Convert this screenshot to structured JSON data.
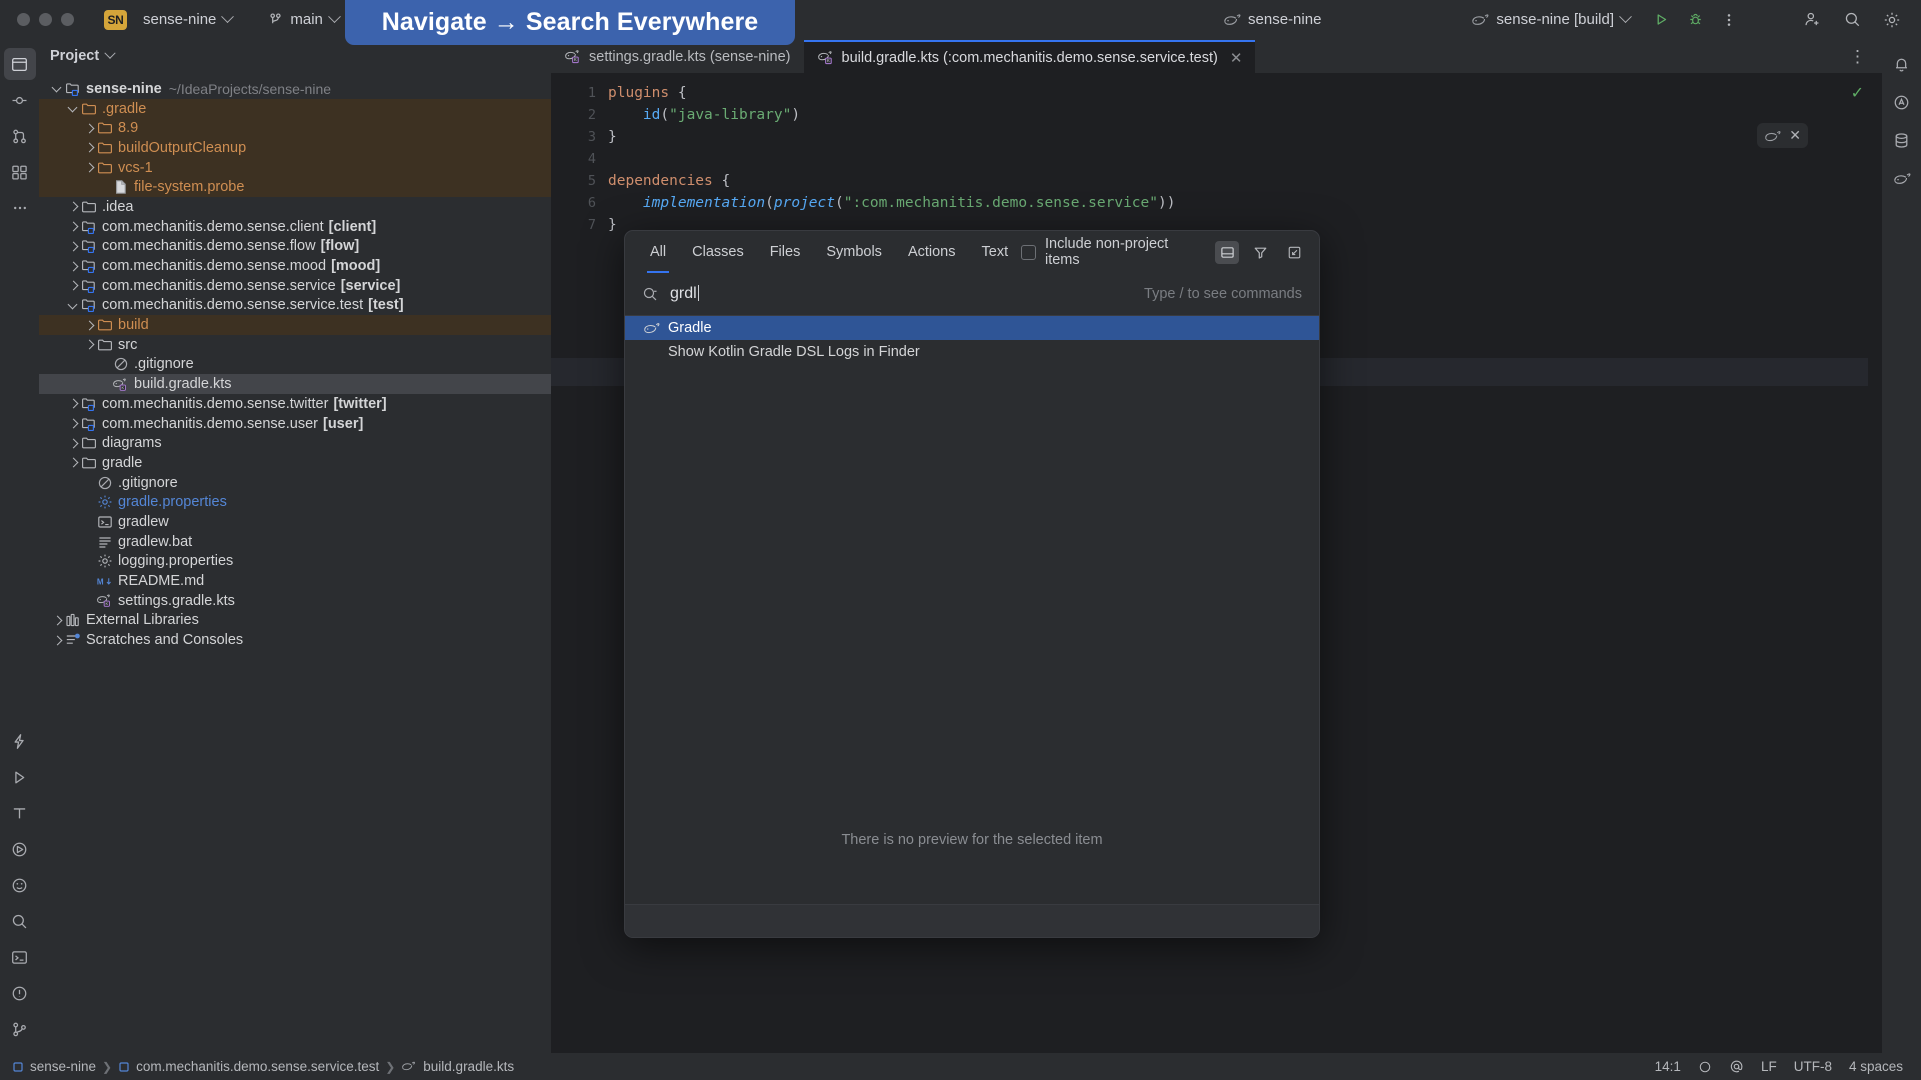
{
  "titlebar": {
    "project_badge": "SN",
    "project_name": "sense-nine",
    "branch": "main",
    "gradle_project": "sense-nine",
    "run_config": "sense-nine [build]",
    "icons": {
      "run": "run-icon",
      "debug": "debug-icon",
      "more": "more-vertical-icon",
      "add_user": "add-user-icon",
      "search": "search-icon",
      "settings": "gear-icon"
    }
  },
  "banner": {
    "text": "Navigate → Search Everywhere",
    "color": "#3c63ad"
  },
  "project_panel": {
    "title": "Project",
    "tree": [
      {
        "label": "sense-nine",
        "suffix": "~/IdeaProjects/sense-nine",
        "indent": 0,
        "arrow": "down",
        "icon": "module-folder-icon",
        "bold": true
      },
      {
        "label": ".gradle",
        "indent": 1,
        "arrow": "down",
        "icon": "folder-icon",
        "style": "excluded"
      },
      {
        "label": "8.9",
        "indent": 2,
        "arrow": "right",
        "icon": "folder-icon",
        "style": "excluded"
      },
      {
        "label": "buildOutputCleanup",
        "indent": 2,
        "arrow": "right",
        "icon": "folder-icon",
        "style": "excluded"
      },
      {
        "label": "vcs-1",
        "indent": 2,
        "arrow": "right",
        "icon": "folder-icon",
        "style": "excluded"
      },
      {
        "label": "file-system.probe",
        "indent": 3,
        "arrow": "none",
        "icon": "file-icon",
        "style": "excluded"
      },
      {
        "label": ".idea",
        "indent": 1,
        "arrow": "right",
        "icon": "folder-icon"
      },
      {
        "label": "com.mechanitis.demo.sense.client",
        "module": "[client]",
        "indent": 1,
        "arrow": "right",
        "icon": "module-folder-icon"
      },
      {
        "label": "com.mechanitis.demo.sense.flow",
        "module": "[flow]",
        "indent": 1,
        "arrow": "right",
        "icon": "module-folder-icon"
      },
      {
        "label": "com.mechanitis.demo.sense.mood",
        "module": "[mood]",
        "indent": 1,
        "arrow": "right",
        "icon": "module-folder-icon"
      },
      {
        "label": "com.mechanitis.demo.sense.service",
        "module": "[service]",
        "indent": 1,
        "arrow": "right",
        "icon": "module-folder-icon"
      },
      {
        "label": "com.mechanitis.demo.sense.service.test",
        "module": "[test]",
        "indent": 1,
        "arrow": "down",
        "icon": "module-folder-icon"
      },
      {
        "label": "build",
        "indent": 2,
        "arrow": "right",
        "icon": "folder-icon",
        "style": "excluded"
      },
      {
        "label": "src",
        "indent": 2,
        "arrow": "right",
        "icon": "folder-icon"
      },
      {
        "label": ".gitignore",
        "indent": 3,
        "arrow": "none",
        "icon": "gitignore-icon"
      },
      {
        "label": "build.gradle.kts",
        "indent": 3,
        "arrow": "none",
        "icon": "gradle-kts-icon",
        "style": "selected"
      },
      {
        "label": "com.mechanitis.demo.sense.twitter",
        "module": "[twitter]",
        "indent": 1,
        "arrow": "right",
        "icon": "module-folder-icon"
      },
      {
        "label": "com.mechanitis.demo.sense.user",
        "module": "[user]",
        "indent": 1,
        "arrow": "right",
        "icon": "module-folder-icon"
      },
      {
        "label": "diagrams",
        "indent": 1,
        "arrow": "right",
        "icon": "folder-icon"
      },
      {
        "label": "gradle",
        "indent": 1,
        "arrow": "right",
        "icon": "folder-icon"
      },
      {
        "label": ".gitignore",
        "indent": 2,
        "arrow": "none",
        "icon": "gitignore-icon"
      },
      {
        "label": "gradle.properties",
        "indent": 2,
        "arrow": "none",
        "icon": "properties-icon",
        "style": "blue"
      },
      {
        "label": "gradlew",
        "indent": 2,
        "arrow": "none",
        "icon": "shell-script-icon"
      },
      {
        "label": "gradlew.bat",
        "indent": 2,
        "arrow": "none",
        "icon": "text-file-icon"
      },
      {
        "label": "logging.properties",
        "indent": 2,
        "arrow": "none",
        "icon": "properties-icon"
      },
      {
        "label": "README.md",
        "indent": 2,
        "arrow": "none",
        "icon": "markdown-icon"
      },
      {
        "label": "settings.gradle.kts",
        "indent": 2,
        "arrow": "none",
        "icon": "gradle-kts-icon"
      },
      {
        "label": "External Libraries",
        "indent": 0,
        "arrow": "right",
        "icon": "library-icon"
      },
      {
        "label": "Scratches and Consoles",
        "indent": 0,
        "arrow": "right",
        "icon": "scratches-icon"
      }
    ]
  },
  "editor": {
    "tabs": [
      {
        "label": "settings.gradle.kts (sense-nine)",
        "icon": "gradle-kts-icon",
        "active": false
      },
      {
        "label": "build.gradle.kts (:com.mechanitis.demo.sense.service.test)",
        "icon": "gradle-kts-icon",
        "active": true,
        "closable": true
      }
    ],
    "gutter": [
      "1",
      "2",
      "3",
      "4",
      "5",
      "6",
      "7"
    ],
    "lines": [
      "plugins {",
      "    id(\"java-library\")",
      "}",
      "",
      "dependencies {",
      "    implementation(project(\":com.mechanitis.demo.sense.service\"))",
      "}"
    ]
  },
  "search_everywhere": {
    "tabs": [
      "All",
      "Classes",
      "Files",
      "Symbols",
      "Actions",
      "Text"
    ],
    "active_tab": "All",
    "include_non_project_label": "Include non-project items",
    "include_non_project_checked": false,
    "header_icons": [
      "preview-panel-icon",
      "filter-icon",
      "resize-icon"
    ],
    "query": "grdl",
    "commands_hint": "Type / to see commands",
    "results": [
      {
        "label": "Gradle",
        "icon": "gradle-icon",
        "selected": true
      },
      {
        "label": "Show Kotlin Gradle DSL Logs in Finder",
        "icon": "none",
        "selected": false
      }
    ],
    "preview_empty_text": "There is no preview for the selected item"
  },
  "status_bar": {
    "breadcrumbs": [
      "sense-nine",
      "com.mechanitis.demo.sense.service.test",
      "build.gradle.kts"
    ],
    "caret": "14:1",
    "line_separator": "LF",
    "encoding": "UTF-8",
    "indent": "4 spaces"
  }
}
